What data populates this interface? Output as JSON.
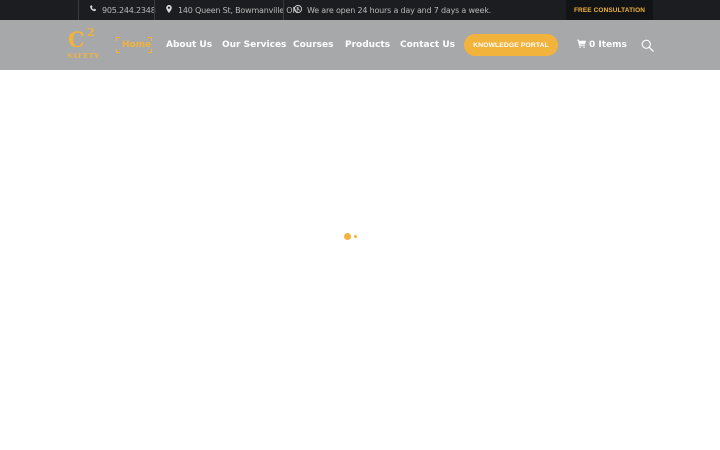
{
  "topbar": {
    "phone": "905.244.2348",
    "address": "140 Queen St, Bowmanville ON",
    "hours": "We are open 24 hours a day and 7 days a week.",
    "consult_label": "FREE CONSULTATION"
  },
  "logo": {
    "mark": "C",
    "superscript": "2",
    "word": "SAFETY"
  },
  "nav": {
    "home": "Home",
    "about": "About Us",
    "services": "Our Services",
    "courses": "Courses",
    "products": "Products",
    "contact": "Contact Us"
  },
  "knowledge_portal": "KNOWLEDGE PORTAL",
  "cart": {
    "label": "0 Items"
  },
  "colors": {
    "accent": "#f2b33d",
    "topbar_bg": "#1c1d20",
    "header_bg": "#a7a8aa"
  }
}
